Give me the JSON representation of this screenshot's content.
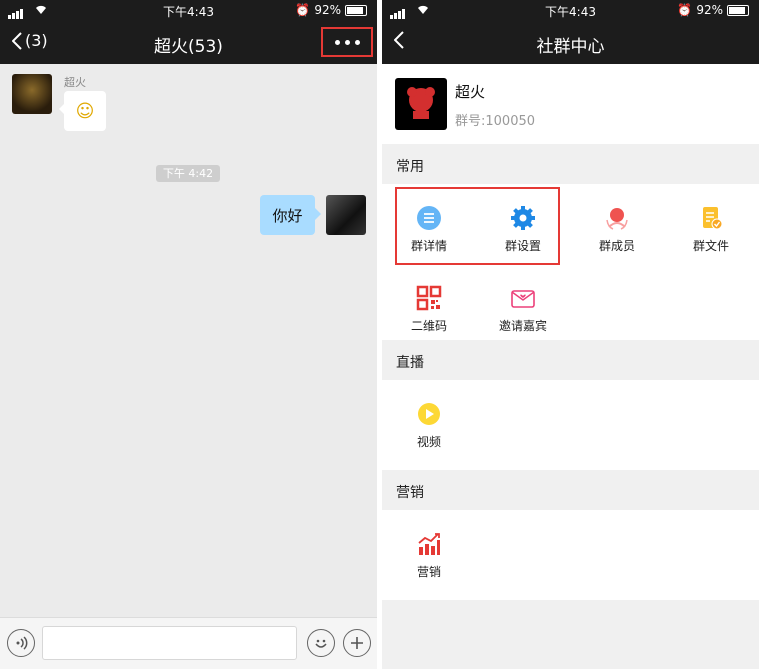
{
  "status": {
    "time": "下午4:43",
    "battery": "92%"
  },
  "left": {
    "back_count": "(3)",
    "title": "超火(53)",
    "sender_name": "超火",
    "emoji": "☺",
    "time_chip": "下午 4:42",
    "my_message": "你好"
  },
  "right": {
    "title": "社群中心",
    "group_name": "超火",
    "group_id": "群号:100050",
    "sections": {
      "common": "常用",
      "live": "直播",
      "marketing": "营销"
    },
    "items": {
      "detail": "群详情",
      "settings": "群设置",
      "members": "群成员",
      "files": "群文件",
      "qrcode": "二维码",
      "invite": "邀请嘉宾",
      "video": "视频",
      "marketing": "营销"
    }
  },
  "colors": {
    "accent_blue": "#1e88e5",
    "highlight_red": "#e53935",
    "bubble_blue": "#a9dcff"
  }
}
